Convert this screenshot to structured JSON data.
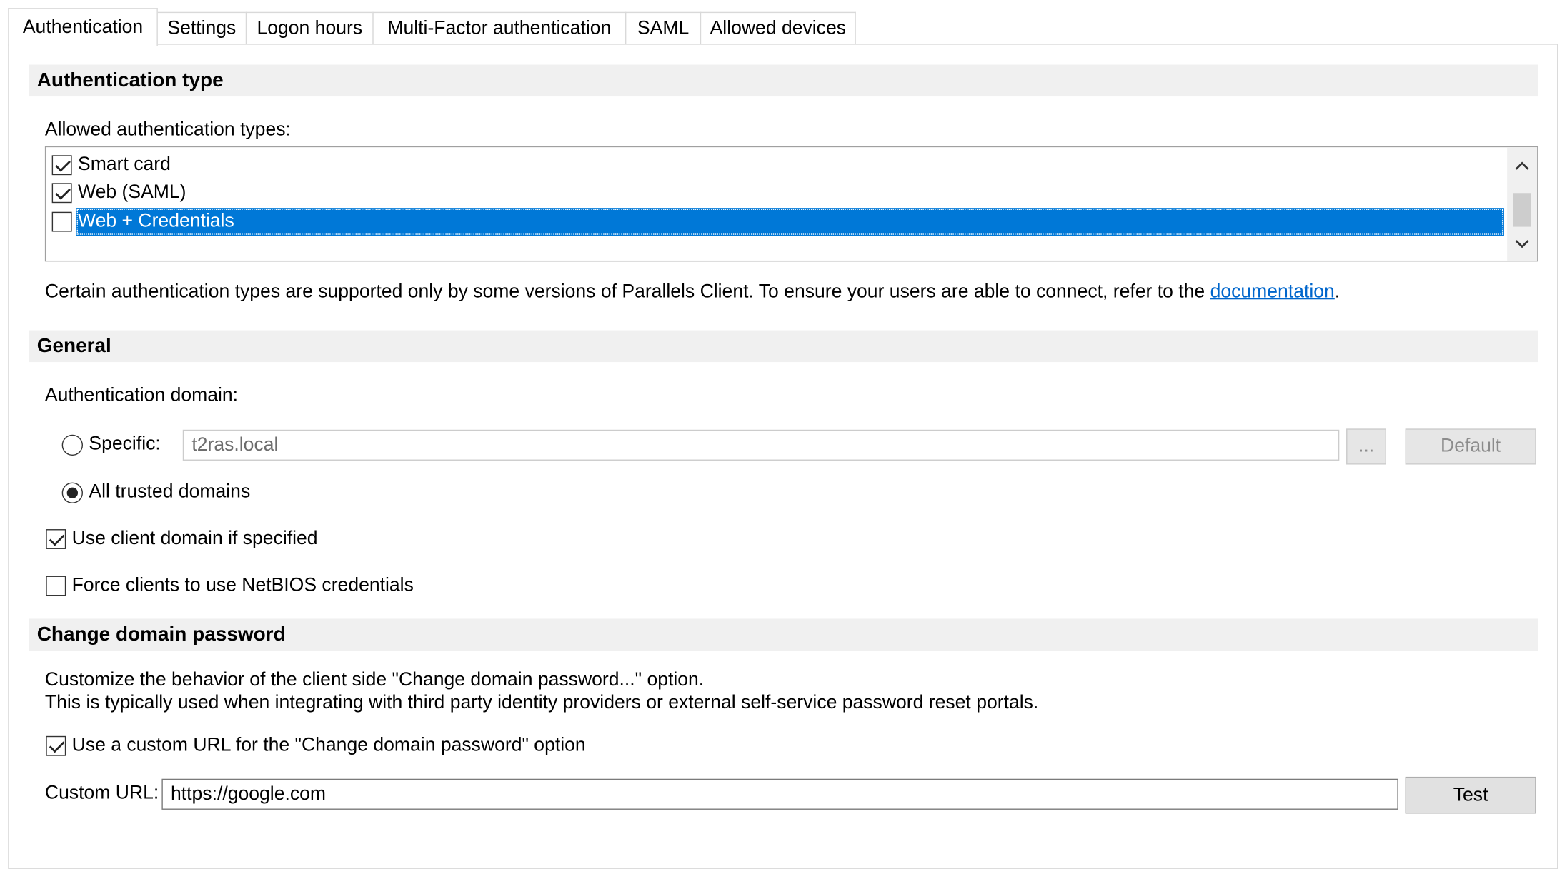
{
  "tabs": [
    {
      "label": "Authentication",
      "active": true
    },
    {
      "label": "Settings",
      "active": false
    },
    {
      "label": "Logon hours",
      "active": false
    },
    {
      "label": "Multi-Factor authentication",
      "active": false
    },
    {
      "label": "SAML",
      "active": false
    },
    {
      "label": "Allowed devices",
      "active": false
    }
  ],
  "auth_type": {
    "header": "Authentication type",
    "allowed_label": "Allowed authentication types:",
    "items": [
      {
        "label": "Smart card",
        "checked": true,
        "selected": false
      },
      {
        "label": "Web (SAML)",
        "checked": true,
        "selected": false
      },
      {
        "label": "Web + Credentials",
        "checked": false,
        "selected": true
      }
    ],
    "info_text": "Certain authentication types are supported only by some versions of Parallels Client. To ensure your users are able to connect, refer to the ",
    "info_link": "documentation",
    "info_end": "."
  },
  "general": {
    "header": "General",
    "domain_label": "Authentication domain:",
    "specific_label": "Specific:",
    "specific_value": "t2ras.local",
    "browse_label": "...",
    "default_label": "Default",
    "all_trusted_label": "All trusted domains",
    "use_client_domain_label": "Use client domain if specified",
    "force_netbios_label": "Force clients to use NetBIOS credentials",
    "specific_selected": false,
    "all_trusted_selected": true,
    "use_client_domain_checked": true,
    "force_netbios_checked": false
  },
  "change_password": {
    "header": "Change domain password",
    "desc_line1": "Customize the behavior of the client side \"Change domain password...\" option.",
    "desc_line2": "This is typically used when integrating with third party identity providers or external self-service password reset portals.",
    "use_custom_url_label": "Use a custom URL for the \"Change domain password\" option",
    "use_custom_url_checked": true,
    "custom_url_label": "Custom URL:",
    "custom_url_value": "https://google.com",
    "test_label": "Test"
  },
  "colors": {
    "selection": "#0078d7",
    "link": "#0066cc",
    "section_bg": "#f0f0f0"
  }
}
